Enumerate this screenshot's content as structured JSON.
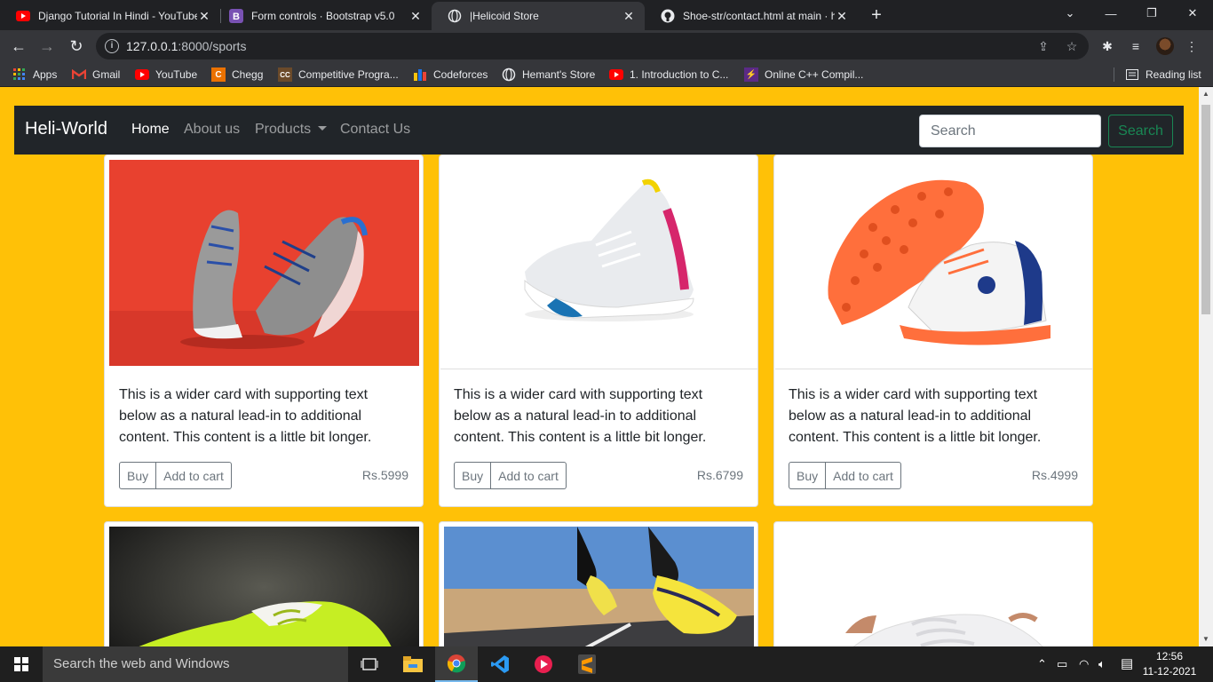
{
  "browser": {
    "tabs": [
      {
        "title": "Django Tutorial In Hindi - YouTube",
        "favicon": "youtube-icon",
        "active": false
      },
      {
        "title": "Form controls · Bootstrap v5.0",
        "favicon": "bootstrap-icon",
        "active": false
      },
      {
        "title": "|Helicoid Store",
        "favicon": "globe-icon",
        "active": true
      },
      {
        "title": "Shoe-str/contact.html at main · h",
        "favicon": "github-icon",
        "active": false
      }
    ],
    "url": "127.0.0.1:8000/sports",
    "url_host": "127.0.0.1",
    "url_rest": ":8000/sports",
    "bookmarks": [
      {
        "label": "Apps",
        "icon": "apps-grid-icon"
      },
      {
        "label": "Gmail",
        "icon": "gmail-icon"
      },
      {
        "label": "YouTube",
        "icon": "youtube-icon"
      },
      {
        "label": "Chegg",
        "icon": "chegg-icon"
      },
      {
        "label": "Competitive Progra...",
        "icon": "cc-icon"
      },
      {
        "label": "Codeforces",
        "icon": "codeforces-icon"
      },
      {
        "label": "Hemant's Store",
        "icon": "globe-icon"
      },
      {
        "label": "1. Introduction to C...",
        "icon": "youtube-icon"
      },
      {
        "label": "Online C++ Compil...",
        "icon": "bolt-icon"
      }
    ],
    "reading_list": "Reading list"
  },
  "navbar": {
    "brand": "Heli-World",
    "links": [
      "Home",
      "About us",
      "Products",
      "Contact Us"
    ],
    "search_placeholder": "Search",
    "search_button": "Search"
  },
  "cards": [
    {
      "text": "This is a wider card with supporting text below as a natural lead-in to additional content. This content is a little bit longer.",
      "buy": "Buy",
      "cart": "Add to cart",
      "price": "Rs.5999"
    },
    {
      "text": "This is a wider card with supporting text below as a natural lead-in to additional content. This content is a little bit longer.",
      "buy": "Buy",
      "cart": "Add to cart",
      "price": "Rs.6799"
    },
    {
      "text": "This is a wider card with supporting text below as a natural lead-in to additional content. This content is a little bit longer.",
      "buy": "Buy",
      "cart": "Add to cart",
      "price": "Rs.4999"
    }
  ],
  "taskbar": {
    "search_placeholder": "Search the web and Windows",
    "time": "12:56",
    "date": "11-12-2021"
  },
  "colors": {
    "page_bg": "#ffc107",
    "navbar_bg": "#212529",
    "success": "#198754",
    "secondary": "#6c757d"
  }
}
